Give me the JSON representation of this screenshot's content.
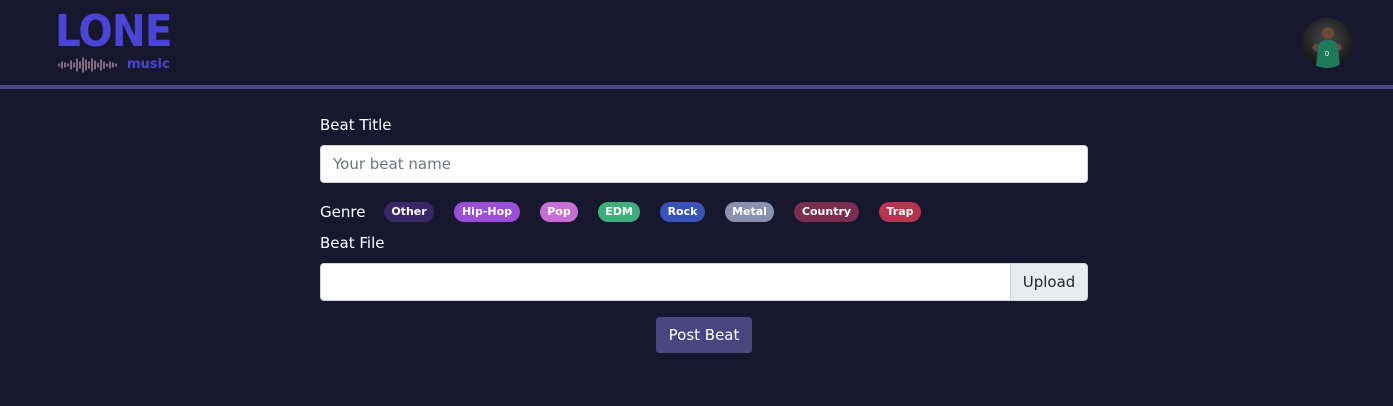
{
  "header": {
    "logo_title": "LONE",
    "logo_subtitle": "music",
    "avatar_icon": "user-avatar"
  },
  "form": {
    "title_label": "Beat Title",
    "title_placeholder": "Your beat name",
    "title_value": "",
    "genre_label": "Genre",
    "genres": [
      {
        "label": "Other",
        "color": "#3a2766"
      },
      {
        "label": "Hip-Hop",
        "color": "#9b4fd9"
      },
      {
        "label": "Pop",
        "color": "#c86fd6"
      },
      {
        "label": "EDM",
        "color": "#3fae7a"
      },
      {
        "label": "Rock",
        "color": "#3a53b8"
      },
      {
        "label": "Metal",
        "color": "#8a91b0"
      },
      {
        "label": "Country",
        "color": "#7a2d4f"
      },
      {
        "label": "Trap",
        "color": "#b5344e"
      }
    ],
    "file_label": "Beat File",
    "file_value": "",
    "upload_label": "Upload",
    "submit_label": "Post Beat"
  },
  "colors": {
    "background": "#171830",
    "accent": "#4a45d4",
    "header_line": "#4a4585",
    "submit_button": "#4a4580"
  }
}
